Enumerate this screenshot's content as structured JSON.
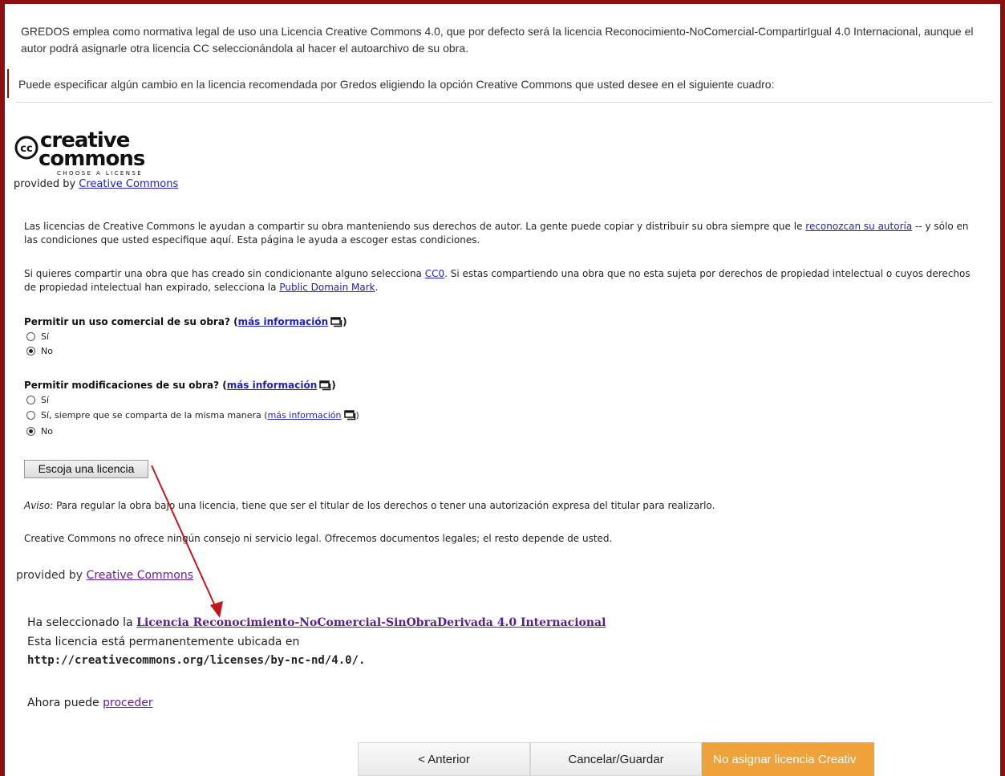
{
  "intro": {
    "line1": "GREDOS emplea como normativa legal de uso una Licencia Creative Commons 4.0, que por defecto será la licencia Reconocimiento-NoComercial-CompartirIgual 4.0 Internacional, aunque el autor podrá asignarle otra licencia CC seleccionándola al hacer el autoarchivo de su obra.",
    "line2": "Puede especificar algún cambio en la licencia recomendada por Gredos eligiendo la opción Creative Commons que usted desee en el siguiente cuadro:"
  },
  "logo": {
    "cc": "cc",
    "creative": "creative",
    "commons": "commons",
    "tagline": "CHOOSE A LICENSE"
  },
  "provided_by": {
    "prefix": "provided by",
    "link": "Creative Commons"
  },
  "para1": {
    "text_a": "Las licencias de Creative Commons le ayudan a compartir su obra manteniendo sus derechos de autor. La gente puede copiar y distribuir su obra siempre que le ",
    "link": "reconozcan su autoría",
    "text_b": " -- y sólo en las condiciones que usted especifique aquí. Esta página le ayuda a escoger estas condiciones."
  },
  "para2": {
    "text_a": "Si quieres compartir una obra que has creado sin condicionante alguno selecciona ",
    "link_cc0": "CC0",
    "text_b": ". Si estas compartiendo una obra que no esta sujeta por derechos de propiedad intelectual o cuyos derechos de propiedad intelectual han expirado, selecciona la ",
    "link_pdm": "Public Domain Mark",
    "text_c": "."
  },
  "q_commercial": {
    "label": "Permitir un uso comercial de su obra?",
    "more": "más información",
    "options": [
      "Sí",
      "No"
    ],
    "selected": "No"
  },
  "q_modifications": {
    "label": "Permitir modificaciones de su obra?",
    "more": "más información",
    "options": [
      "Sí",
      "Sí, siempre que se comparta de la misma manera",
      "No"
    ],
    "option_more": "más información",
    "selected": "No"
  },
  "choose_button": "Escoja una licencia",
  "aviso": {
    "label": "Aviso:",
    "text": " Para regular la obra bajo una licencia, tiene que ser el titular de los derechos o tener una autorización expresa del titular para realizarlo."
  },
  "disclaimer": "Creative Commons no ofrece ningún consejo ni servicio legal. Ofrecemos documentos legales; el resto depende de usted.",
  "result": {
    "selected_prefix": "Ha seleccionado la ",
    "license_name": "Licencia Reconocimiento-NoComercial-SinObraDerivada 4.0 Internacional",
    "located_text": "Esta licencia está permanentemente ubicada en",
    "url": "http://creativecommons.org/licenses/by-nc-nd/4.0/",
    "url_suffix": ".",
    "proceed_prefix": "Ahora puede ",
    "proceed_link": "proceder"
  },
  "buttons": {
    "prev": "< Anterior",
    "cancel": "Cancelar/Guardar",
    "no_license": "No asignar licencia Creativ"
  },
  "colors": {
    "frame": "#8b1010",
    "annotation_arrow": "#c0181f",
    "orange_button": "#f0a23a",
    "link": "#1f1fbf",
    "visited": "#6a1b9a"
  }
}
